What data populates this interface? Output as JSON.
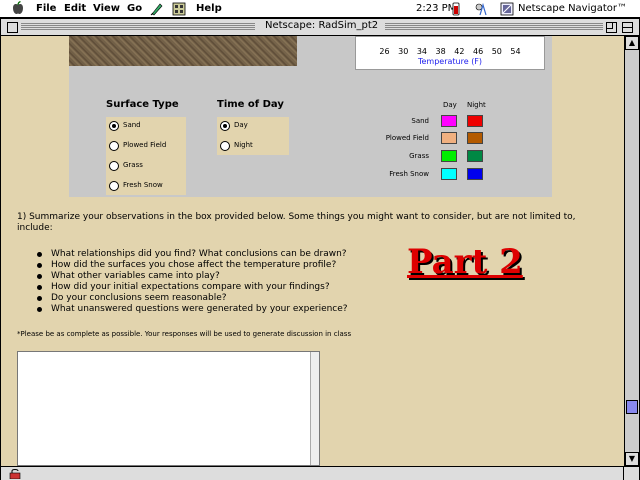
{
  "menubar": {
    "items": [
      "File",
      "Edit",
      "View",
      "Go",
      "Help"
    ],
    "clock": "2:23 PM",
    "app_name": "Netscape Navigator™"
  },
  "window": {
    "title": "Netscape: RadSim_pt2"
  },
  "sim": {
    "temperature_scale": "26 30 34 38 42 46 50 54",
    "temperature_label": "Temperature (F)",
    "surface": {
      "title": "Surface Type",
      "options": [
        "Sand",
        "Plowed Field",
        "Grass",
        "Fresh Snow"
      ],
      "selected": "Sand"
    },
    "time": {
      "title": "Time of Day",
      "options": [
        "Day",
        "Night"
      ],
      "selected": "Day"
    },
    "legend": {
      "day_label": "Day",
      "night_label": "Night",
      "rows": [
        {
          "label": "Sand",
          "day_color": "#ff00ff",
          "night_color": "#ee0000"
        },
        {
          "label": "Plowed Field",
          "day_color": "#f0b080",
          "night_color": "#b35a00"
        },
        {
          "label": "Grass",
          "day_color": "#00ee00",
          "night_color": "#008844"
        },
        {
          "label": "Fresh Snow",
          "day_color": "#00ffff",
          "night_color": "#0000ee"
        }
      ]
    }
  },
  "body": {
    "question": "1) Summarize your observations in the box provided below. Some things you might want to consider, but are not limited to, include:",
    "bullets": [
      "What relationships did you find? What conclusions can be drawn?",
      "How did the surfaces you chose affect the temperature profile?",
      "What other variables came into play?",
      "How did your initial expectations compare with your findings?",
      "Do your conclusions seem reasonable?",
      "What unanswered questions were generated by your experience?"
    ],
    "part_title": "Part 2",
    "note": "*Please be as complete as possible. Your responses will be used to generate discussion in class",
    "response_value": ""
  },
  "colors": {
    "page_background": "#e2d4ae",
    "panel_background": "#c8c8c8",
    "part_title": "#dd0000"
  }
}
